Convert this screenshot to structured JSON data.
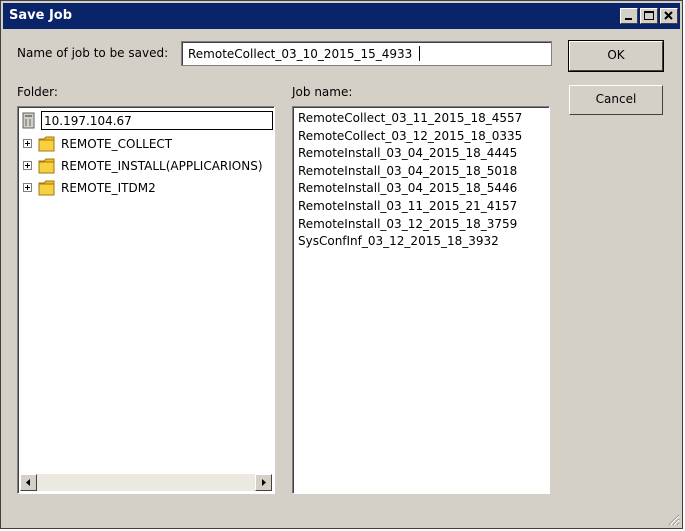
{
  "window": {
    "title": "Save Job",
    "controls": {
      "minimize": "minimize-icon",
      "maximize": "maximize-icon",
      "close": "close-icon"
    }
  },
  "form": {
    "name_label": "Name of job to be saved:",
    "name_value": "RemoteCollect_03_10_2015_15_4933",
    "folder_label": "Folder:",
    "jobname_label": "Job name:"
  },
  "buttons": {
    "ok": "OK",
    "cancel": "Cancel"
  },
  "folder_tree": {
    "root": "10.197.104.67",
    "items": [
      {
        "label": "REMOTE_COLLECT"
      },
      {
        "label": "REMOTE_INSTALL(APPLICARIONS)"
      },
      {
        "label": "REMOTE_ITDM2"
      }
    ]
  },
  "jobs": [
    "RemoteCollect_03_11_2015_18_4557",
    "RemoteCollect_03_12_2015_18_0335",
    "RemoteInstall_03_04_2015_18_4445",
    "RemoteInstall_03_04_2015_18_5018",
    "RemoteInstall_03_04_2015_18_5446",
    "RemoteInstall_03_11_2015_21_4157",
    "RemoteInstall_03_12_2015_18_3759",
    "SysConfInf_03_12_2015_18_3932"
  ],
  "colors": {
    "titlebar": "#0a246a",
    "face": "#d4d0c8"
  }
}
